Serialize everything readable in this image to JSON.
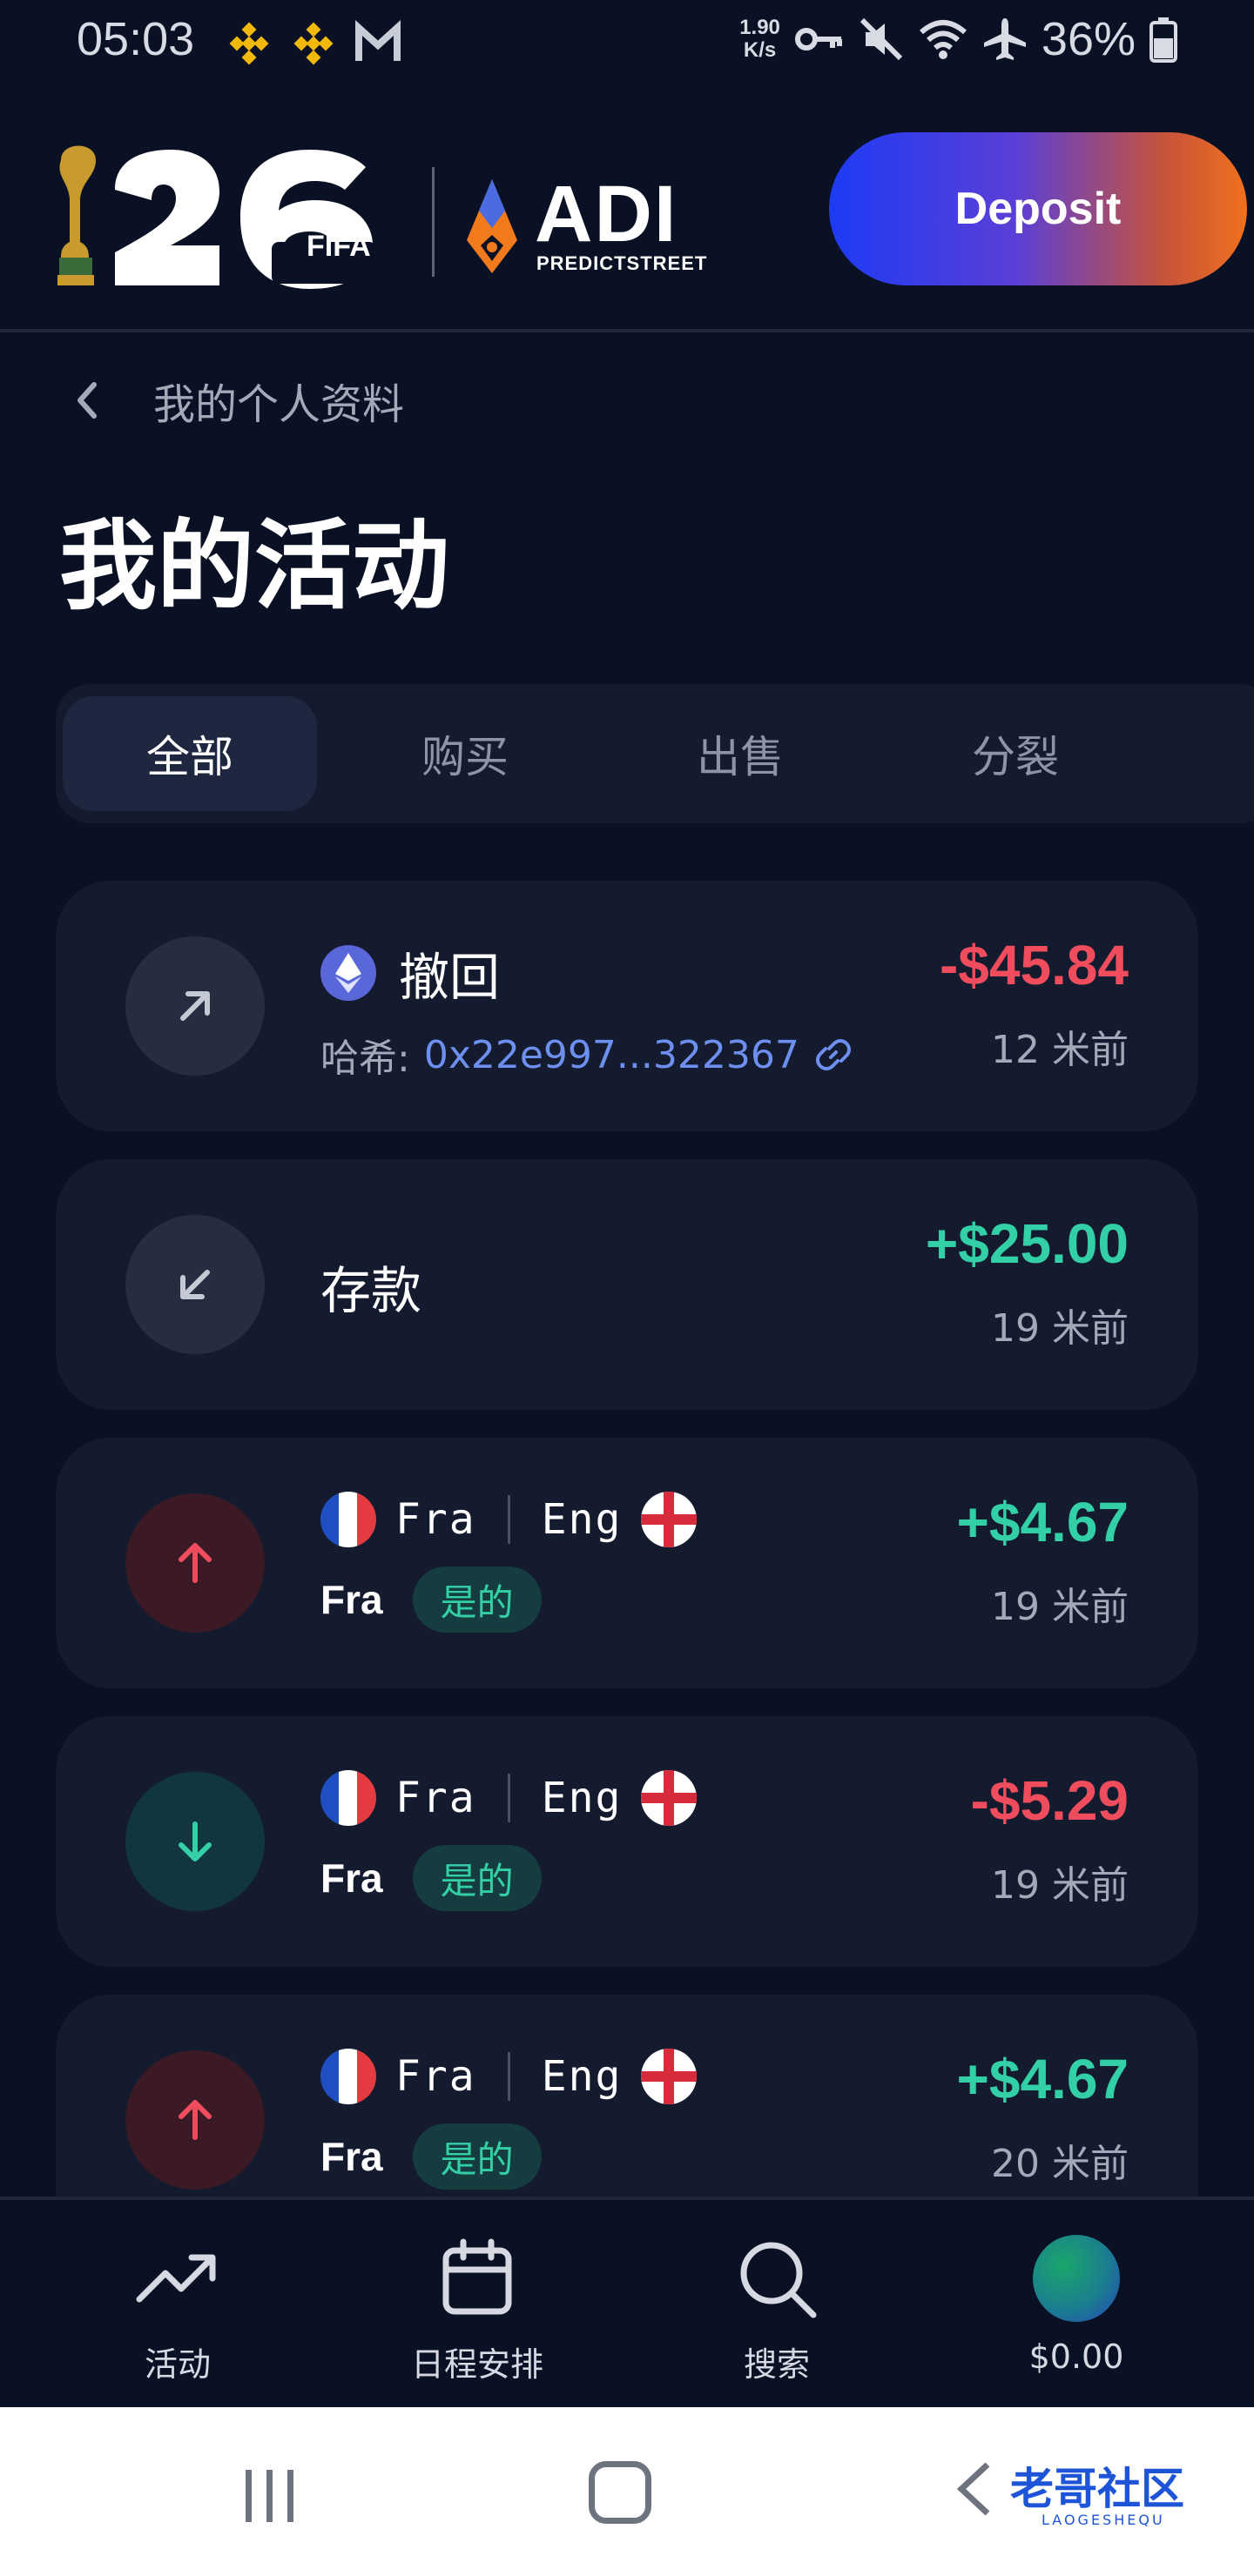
{
  "status_bar": {
    "time": "05:03",
    "net_speed_value": "1.90",
    "net_speed_unit": "K/s",
    "battery": "36%"
  },
  "header": {
    "wc_logo_text": "FIFA",
    "adi_logo_text": "ADI",
    "adi_logo_sub": "PREDICTSTREET",
    "deposit_label": "Deposit"
  },
  "breadcrumb": {
    "label": "我的个人资料"
  },
  "page_title": "我的活动",
  "tabs": [
    {
      "label": "全部",
      "active": true
    },
    {
      "label": "购买",
      "active": false
    },
    {
      "label": "出售",
      "active": false
    },
    {
      "label": "分裂",
      "active": false
    }
  ],
  "activities": [
    {
      "type": "withdraw",
      "icon": "arrow-up-right-icon",
      "title": "撤回",
      "hash_label": "哈希:",
      "hash": "0x22e997...322367",
      "amount": "-$45.84",
      "time": "12 米前"
    },
    {
      "type": "deposit",
      "icon": "arrow-down-left-icon",
      "title": "存款",
      "amount": "+$25.00",
      "time": "19 米前"
    },
    {
      "type": "trade",
      "icon": "arrow-up-icon",
      "team_a": "Fra",
      "team_b": "Eng",
      "selection": "Fra",
      "badge": "是的",
      "amount": "+$4.67",
      "time": "19 米前"
    },
    {
      "type": "trade",
      "icon": "arrow-down-icon",
      "team_a": "Fra",
      "team_b": "Eng",
      "selection": "Fra",
      "badge": "是的",
      "amount": "-$5.29",
      "time": "19 米前"
    },
    {
      "type": "trade",
      "icon": "arrow-up-icon",
      "team_a": "Fra",
      "team_b": "Eng",
      "selection": "Fra",
      "badge": "是的",
      "amount": "+$4.67",
      "time": "20 米前"
    }
  ],
  "bottom_nav": [
    {
      "label": "活动",
      "icon": "trending-up-icon"
    },
    {
      "label": "日程安排",
      "icon": "calendar-icon"
    },
    {
      "label": "搜索",
      "icon": "search-icon"
    },
    {
      "label": "$0.00",
      "icon": "avatar"
    }
  ],
  "watermark": {
    "text": "老哥社区",
    "sub": "LAOGESHEQU"
  },
  "colors": {
    "background": "#0b1124",
    "card": "#141b2e",
    "negative": "#ef4d5d",
    "positive": "#33d0a8",
    "link": "#6d8ff0"
  }
}
